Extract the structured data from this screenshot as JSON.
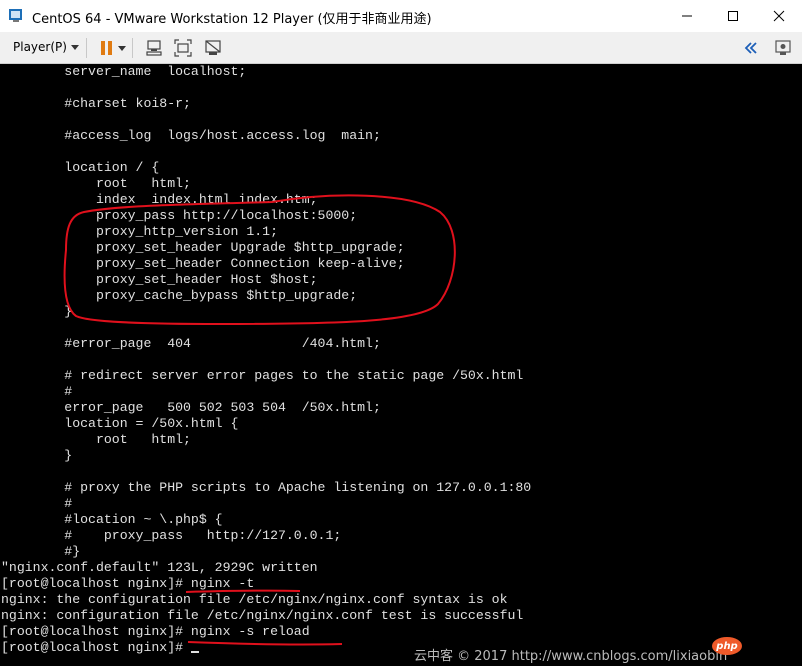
{
  "window": {
    "title": "CentOS 64 - VMware Workstation 12 Player (仅用于非商业用途)"
  },
  "toolbar": {
    "player_menu_label": "Player(P)",
    "icons": [
      "pause-icon",
      "send-keys-icon",
      "fullscreen-icon",
      "unity-icon",
      "collapse-left-icon",
      "vm-settings-icon"
    ]
  },
  "colors": {
    "terminal_background": "#000000",
    "terminal_text": "#e0e0e0",
    "annotation_red": "#e0101c",
    "pause_orange": "#e07b12"
  },
  "terminal": {
    "lines": [
      "        server_name  localhost;",
      "",
      "        #charset koi8-r;",
      "",
      "        #access_log  logs/host.access.log  main;",
      "",
      "        location / {",
      "            root   html;",
      "            index  index.html index.htm;",
      "            proxy_pass http://localhost:5000;",
      "            proxy_http_version 1.1;",
      "            proxy_set_header Upgrade $http_upgrade;",
      "            proxy_set_header Connection keep-alive;",
      "            proxy_set_header Host $host;",
      "            proxy_cache_bypass $http_upgrade;",
      "        }",
      "",
      "        #error_page  404              /404.html;",
      "",
      "        # redirect server error pages to the static page /50x.html",
      "        #",
      "        error_page   500 502 503 504  /50x.html;",
      "        location = /50x.html {",
      "            root   html;",
      "        }",
      "",
      "",
      "        # proxy the PHP scripts to Apache listening on 127.0.0.1:80",
      "        #",
      "        #location ~ \\.php$ {",
      "        #    proxy_pass   http://127.0.0.1;",
      "        #}",
      "\"nginx.conf.default\" 123L, 2929C written",
      "[root@localhost nginx]# nginx -t",
      "nginx: the configuration file /etc/nginx/nginx.conf syntax is ok",
      "nginx: configuration file /etc/nginx/nginx.conf test is successful",
      "[root@localhost nginx]# nginx -s reload",
      "[root@localhost nginx]# "
    ]
  },
  "watermark": {
    "text": "云中客 © 2017 http://www.cnblogs.com/lixiaobin",
    "logo_text": "php"
  }
}
